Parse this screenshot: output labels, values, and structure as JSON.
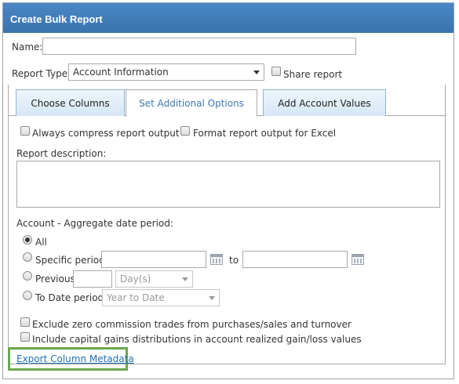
{
  "dialog": {
    "title": "Create Bulk Report"
  },
  "form": {
    "name_label": "Name:",
    "name_value": "",
    "report_type_label": "Report Type:",
    "report_type_value": "Account Information",
    "share_report_label": "Share report",
    "share_report_checked": false
  },
  "tabs": [
    {
      "label": "Choose Columns",
      "active": false
    },
    {
      "label": "Set Additional Options",
      "active": true
    },
    {
      "label": "Add Account Values",
      "active": false
    }
  ],
  "options": {
    "always_compress_label": "Always compress report output",
    "always_compress_checked": false,
    "format_excel_label": "Format report output for Excel",
    "format_excel_checked": false,
    "description_label": "Report description:",
    "description_value": "",
    "aggregate_label": "Account - Aggregate date period:",
    "period_options": {
      "all_label": "All",
      "specific_label": "Specific period:",
      "to_label": "to",
      "previous_label": "Previous",
      "previous_unit": "Day(s)",
      "to_date_label": "To Date period:",
      "to_date_value": "Year to Date",
      "selected": "All"
    },
    "exclude_zero_label": "Exclude zero commission trades from purchases/sales and turnover",
    "exclude_zero_checked": false,
    "include_cap_gains_label": "Include capital gains distributions in account realized gain/loss values",
    "include_cap_gains_checked": false,
    "export_link_label": "Export Column Metadata"
  },
  "colors": {
    "title_bar": "#3f7cbb",
    "active_tab_text": "#3f78b4",
    "link": "#1f6fb5",
    "highlight_border": "#6aa84f"
  }
}
